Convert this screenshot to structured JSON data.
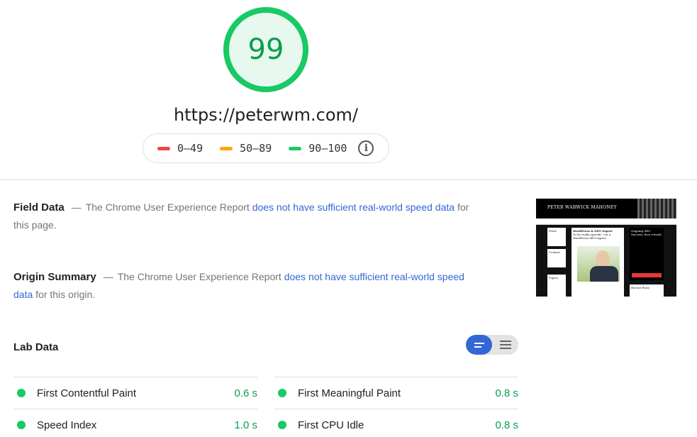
{
  "score": {
    "value": "99",
    "color": "#18c964"
  },
  "url": "https://peterwm.com/",
  "legend": {
    "items": [
      {
        "label": "0–49",
        "color": "#f4433c"
      },
      {
        "label": "50–89",
        "color": "#ffa400"
      },
      {
        "label": "90–100",
        "color": "#18c964"
      }
    ],
    "info_icon": "info-icon"
  },
  "field_data": {
    "title": "Field Data",
    "dash": "—",
    "text_before": "The Chrome User Experience Report",
    "link": "does not have sufficient real-world speed data",
    "text_after": "for this page."
  },
  "origin_summary": {
    "title": "Origin Summary",
    "dash": "—",
    "text_before": "The Chrome User Experience Report",
    "link": "does not have sufficient real-world speed data",
    "text_after": "for this origin."
  },
  "screenshot": {
    "site_title": "PETER WARWICK MAHONEY",
    "col_left_1": "Peter",
    "col_left_2": "Contact",
    "col_left_3": "Topics",
    "col_mid_title": "WordPress & SEO Expert",
    "col_mid_sub": "To be really specific, I'm a WordPress SEO expert.",
    "col_right_title": "Ongoing SEO Success, free e-book!",
    "col_right_bottom": "Recent Posts"
  },
  "lab_data": {
    "title": "Lab Data",
    "metrics": [
      {
        "name": "First Contentful Paint",
        "value": "0.6 s"
      },
      {
        "name": "First Meaningful Paint",
        "value": "0.8 s"
      },
      {
        "name": "Speed Index",
        "value": "1.0 s"
      },
      {
        "name": "First CPU Idle",
        "value": "0.8 s"
      }
    ],
    "good_color": "#18c964"
  }
}
